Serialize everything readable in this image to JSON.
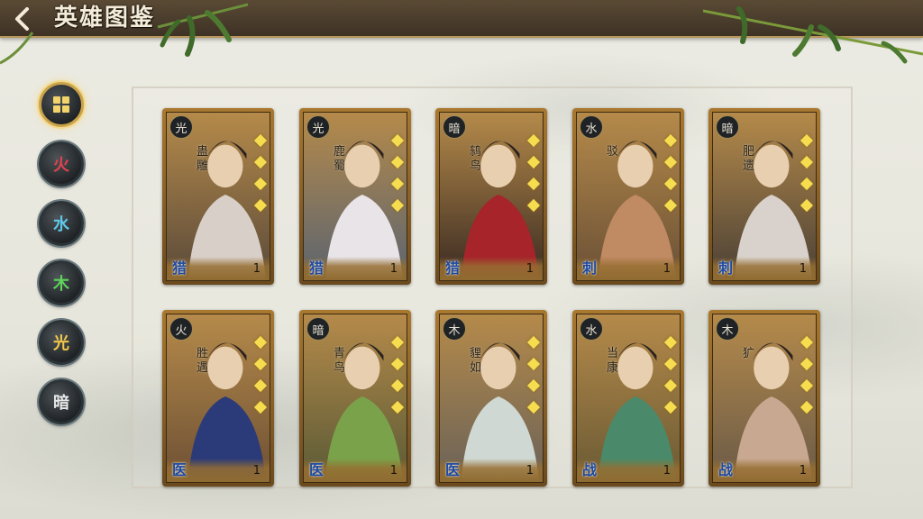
{
  "header": {
    "title": "英雄图鉴"
  },
  "filters": [
    {
      "id": "all",
      "label": "",
      "active": true
    },
    {
      "id": "fire",
      "label": "火",
      "color": "#e0424e"
    },
    {
      "id": "water",
      "label": "水",
      "color": "#5fc8e8"
    },
    {
      "id": "wood",
      "label": "木",
      "color": "#5fd35a"
    },
    {
      "id": "light",
      "label": "光",
      "color": "#f2c64a"
    },
    {
      "id": "dark",
      "label": "暗",
      "color": "#e8e8e8"
    }
  ],
  "heroes": [
    {
      "element": "光",
      "name": "蛊雕",
      "role": "猎",
      "level": "1",
      "art": "#5a4a3a",
      "accent": "#d8d0c8"
    },
    {
      "element": "光",
      "name": "鹿蜀",
      "role": "猎",
      "level": "1",
      "art": "#5b6470",
      "accent": "#e8e4e8"
    },
    {
      "element": "暗",
      "name": "鸫鸟",
      "role": "猎",
      "level": "1",
      "art": "#3a2a22",
      "accent": "#a6242a"
    },
    {
      "element": "水",
      "name": "驳",
      "role": "刺",
      "level": "1",
      "art": "#6a5036",
      "accent": "#c08a62"
    },
    {
      "element": "暗",
      "name": "肥遗",
      "role": "刺",
      "level": "1",
      "art": "#4a4036",
      "accent": "#d9d2cc"
    },
    {
      "element": "火",
      "name": "胜遇",
      "role": "医",
      "level": "1",
      "art": "#6d5034",
      "accent": "#2b3a78"
    },
    {
      "element": "暗",
      "name": "青鸟",
      "role": "医",
      "level": "1",
      "art": "#5a5a36",
      "accent": "#7aa24a"
    },
    {
      "element": "木",
      "name": "貍如",
      "role": "医",
      "level": "1",
      "art": "#6a6258",
      "accent": "#cfd8d2"
    },
    {
      "element": "水",
      "name": "当康",
      "role": "战",
      "level": "1",
      "art": "#6a5a34",
      "accent": "#4a8a6a"
    },
    {
      "element": "木",
      "name": "犷",
      "role": "战",
      "level": "1",
      "art": "#6a5a48",
      "accent": "#c8a890"
    }
  ]
}
